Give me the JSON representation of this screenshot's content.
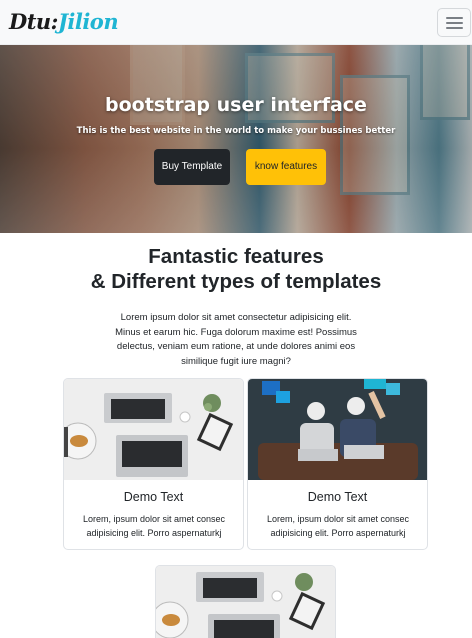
{
  "navbar": {
    "brand_part1": "Dtu:",
    "brand_part2": "Jilion",
    "toggler_icon": "hamburger-menu-icon"
  },
  "hero": {
    "title": "bootstrap user interface",
    "subtitle": "This is the best website in the world to make your bussines better",
    "primary_button": "Buy Template",
    "secondary_button": "know features"
  },
  "features": {
    "title_line1": "Fantastic features",
    "title_line2": "& Different types of templates",
    "body": "Lorem ipsum dolor sit amet consectetur adipisicing elit. Minus et earum hic. Fuga dolorum maxime est! Possimus delectus, veniam eum ratione, at unde dolores animi eos similique fugit iure magni?"
  },
  "cards": [
    {
      "title": "Demo Text",
      "text": "Lorem, ipsum dolor sit amet consec adipisicing elit. Porro aspernaturkj"
    },
    {
      "title": "Demo Text",
      "text": "Lorem, ipsum dolor sit amet consec adipisicing elit. Porro aspernaturkj"
    }
  ],
  "colors": {
    "navbar_bg": "#f8f9fa",
    "brand_accent": "#1fb5d3",
    "dark_button": "#212529",
    "warning_button": "#ffc107"
  }
}
